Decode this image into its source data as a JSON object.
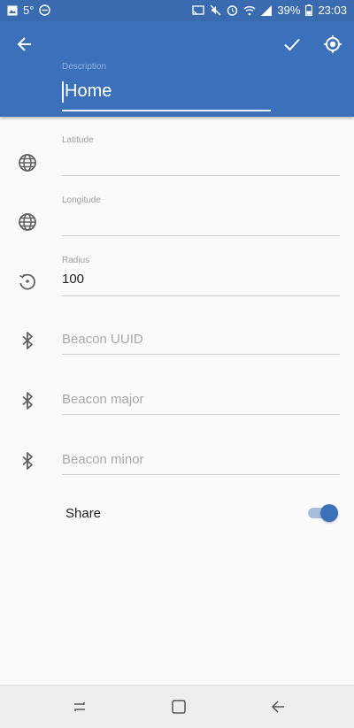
{
  "status_bar": {
    "temperature": "5°",
    "battery": "39%",
    "time": "23:03",
    "icons_left": [
      "image-icon",
      "dnd-icon"
    ],
    "icons_right": [
      "cast-icon",
      "mute-icon",
      "alarm-icon",
      "wifi-icon",
      "signal-icon",
      "battery-icon"
    ]
  },
  "toolbar": {
    "back_icon": "arrow-left-icon",
    "confirm_icon": "check-icon",
    "locate_icon": "my-location-icon",
    "description_label": "Description",
    "description_value": "Home"
  },
  "form": {
    "latitude": {
      "label": "Latitude",
      "value": "",
      "icon": "globe-icon"
    },
    "longitude": {
      "label": "Longitude",
      "value": "",
      "icon": "globe-icon"
    },
    "radius": {
      "label": "Radius",
      "value": "100",
      "icon": "radius-icon"
    },
    "beacon_uuid": {
      "placeholder": "Beacon UUID",
      "icon": "bluetooth-icon"
    },
    "beacon_major": {
      "placeholder": "Beacon major",
      "icon": "bluetooth-icon"
    },
    "beacon_minor": {
      "placeholder": "Beacon minor",
      "icon": "bluetooth-icon"
    },
    "share": {
      "label": "Share",
      "enabled": true
    }
  },
  "colors": {
    "primary": "#3b71bb",
    "status_bar": "#3a6bb0",
    "switch_track": "#a8bedf",
    "background": "#fafafa"
  },
  "nav_bar": {
    "icons": [
      "recents-icon",
      "home-icon",
      "back-icon"
    ]
  }
}
